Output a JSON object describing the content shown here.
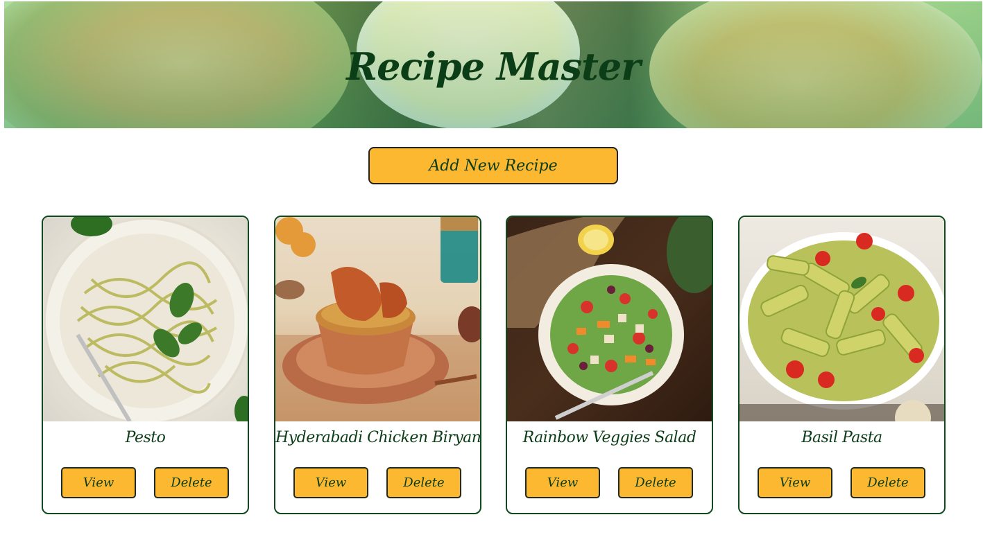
{
  "header": {
    "title": "Recipe Master"
  },
  "actions": {
    "add_label": "Add New Recipe"
  },
  "recipes": [
    {
      "name": "Pesto",
      "view_label": "View",
      "delete_label": "Delete"
    },
    {
      "name": "Hyderabadi Chicken Biryani",
      "view_label": "View",
      "delete_label": "Delete"
    },
    {
      "name": "Rainbow Veggies Salad",
      "view_label": "View",
      "delete_label": "Delete"
    },
    {
      "name": "Basil Pasta",
      "view_label": "View",
      "delete_label": "Delete"
    }
  ],
  "colors": {
    "accent": "#fcb830",
    "text": "#0b3d17",
    "border": "#0e4a1d"
  }
}
